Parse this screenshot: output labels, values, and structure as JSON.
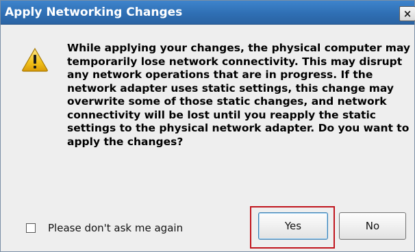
{
  "window": {
    "title": "Apply Networking Changes",
    "close_glyph": "×",
    "icon": "warning-icon"
  },
  "message": {
    "text": "While applying your changes, the physical computer may temporarily lose network connectivity. This may disrupt any network operations that are in progress. If the network adapter uses static settings, this change may overwrite some of those static changes, and network connectivity will be lost until you reapply the static settings to the physical network adapter. Do you want to apply the changes?"
  },
  "options": {
    "dont_ask_label": "Please don't ask me again",
    "dont_ask_checked": false
  },
  "buttons": {
    "yes_label": "Yes",
    "no_label": "No"
  },
  "colors": {
    "titlebar": "#2f6fb4",
    "highlight": "#c0141c",
    "warning": "#f2c21a"
  }
}
